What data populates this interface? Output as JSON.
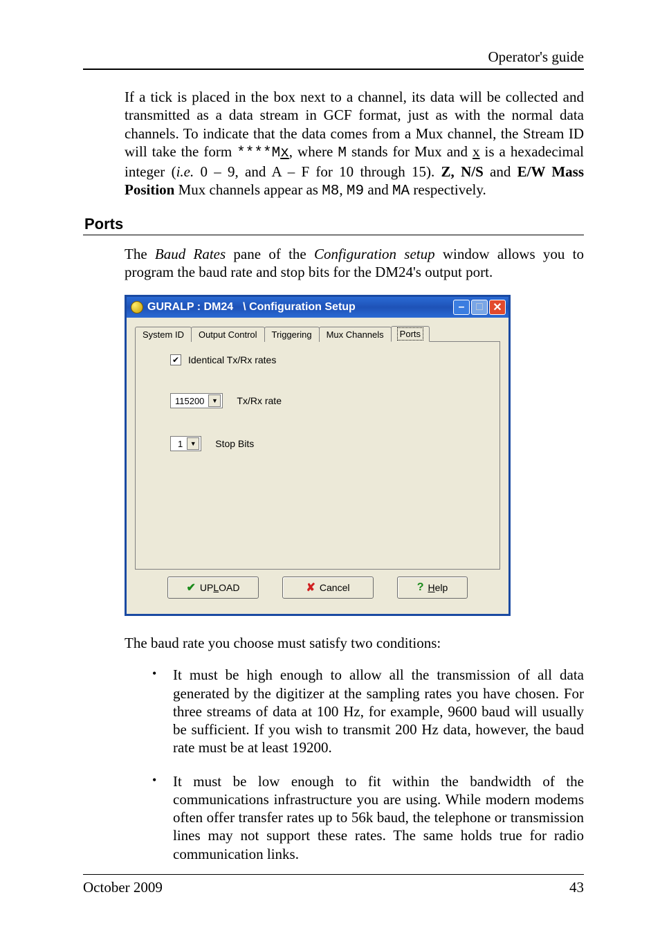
{
  "header": {
    "running": "Operator's guide"
  },
  "para1_a": "If a tick is placed in the box next to a channel, its data will be collected and transmitted as a data stream in GCF format, just as with the normal data channels. To indicate that the data comes from a Mux channel, the Stream ID will take the form ",
  "para1_code1": "****M",
  "para1_code1u": "x",
  "para1_b": ", where ",
  "para1_code2": "M",
  "para1_c": " stands for Mux and ",
  "para1_u": "x",
  "para1_d": " is a hexadecimal integer (",
  "para1_ie": "i.e.",
  "para1_e": " 0 – 9, and A – F for 10 through 15). ",
  "para1_bold1": "Z, N/S",
  "para1_f": " and ",
  "para1_bold2": "E/W Mass Position",
  "para1_g": " Mux channels appear as ",
  "para1_code3": "M8",
  "para1_code4": "M9",
  "para1_h": " and ",
  "para1_code5": "MA",
  "para1_i": " respectively.",
  "ports_heading": "Ports",
  "para2_a": "The ",
  "para2_it1": "Baud Rates",
  "para2_b": " pane of the ",
  "para2_it2": "Configuration setup",
  "para2_c": " window allows you to program the baud rate and stop bits for the DM24's output port.",
  "dialog": {
    "title_left": "GURALP : DM24",
    "title_right": "\\ Configuration Setup",
    "tabs": [
      "System ID",
      "Output Control",
      "Triggering",
      "Mux Channels",
      "Ports"
    ],
    "active_tab": 4,
    "identical_label": "Identical Tx/Rx rates",
    "identical_checked": true,
    "txrx_value": "115200",
    "txrx_label": "Tx/Rx rate",
    "stop_value": "1",
    "stop_label": "Stop Bits",
    "btn_upload_pre": "UP",
    "btn_upload_ul": "L",
    "btn_upload_post": "OAD",
    "btn_cancel": "Cancel",
    "btn_help_ul": "H",
    "btn_help_post": "elp"
  },
  "para3": "The baud rate you choose must satisfy two conditions:",
  "bullets": [
    "It must be high enough to allow all the transmission of all data generated by the digitizer at the sampling rates you have chosen. For three streams of data at 100 Hz, for example, 9600 baud will usually be sufficient. If you wish to transmit 200 Hz data, however, the baud rate must be at least 19200.",
    "It must be low enough to fit within the bandwidth of the communications infrastructure you are using. While modern modems often offer transfer rates up to 56k baud, the telephone or transmission lines may not support these rates. The same holds true for radio communication links."
  ],
  "footer": {
    "left": "October 2009",
    "right": "43"
  }
}
